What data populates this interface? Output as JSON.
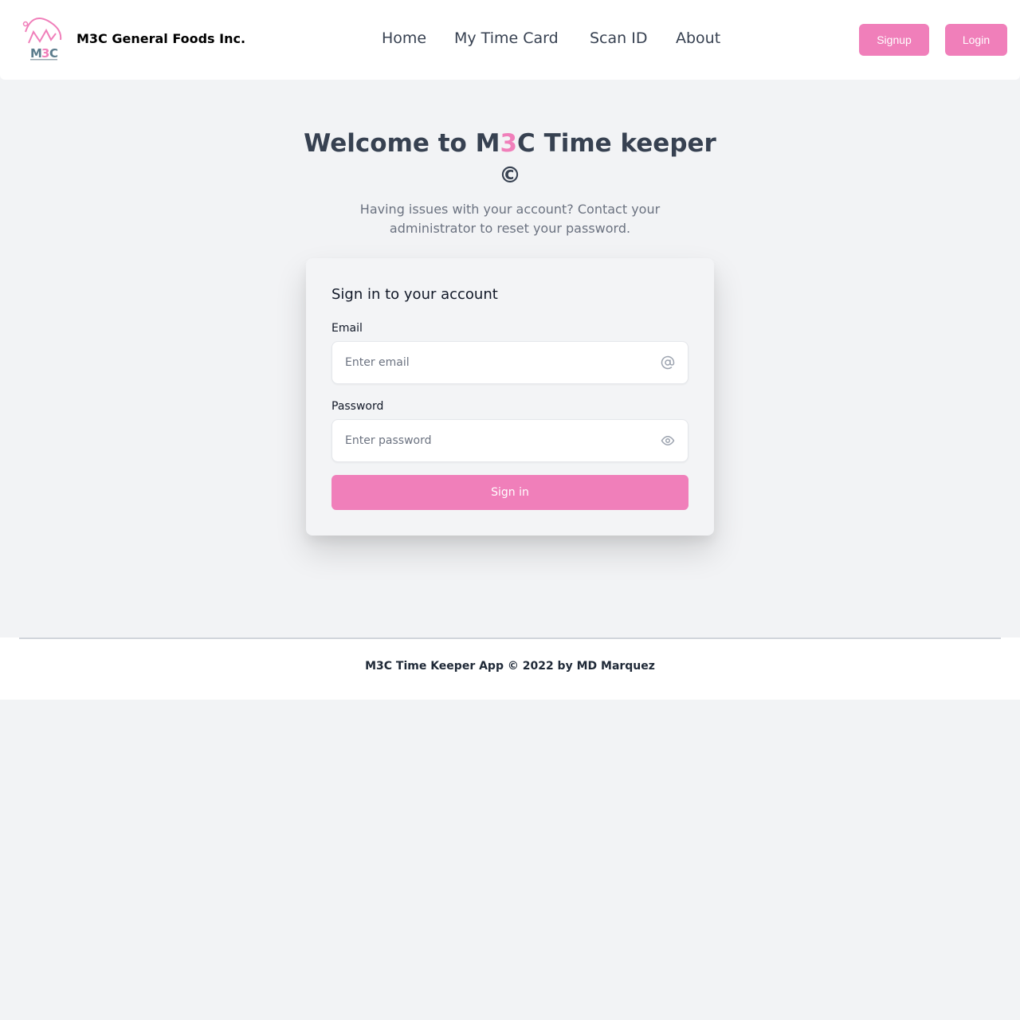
{
  "colors": {
    "accent": "#f07fba",
    "background": "#f2f3f5",
    "text": "#374151"
  },
  "header": {
    "logo_text": "M3C",
    "brand": "M3C General Foods Inc.",
    "nav": [
      "Home",
      "My Time Card",
      "Scan ID",
      "About"
    ],
    "signup_label": "Signup",
    "login_label": "Login"
  },
  "hero": {
    "title_pre": "Welcome to M",
    "title_accent": "3",
    "title_post": "C Time keeper",
    "title_symbol": "©",
    "subtitle": "Having issues with your account? Contact your administrator to reset your password."
  },
  "form": {
    "title": "Sign in to your account",
    "email_label": "Email",
    "email_placeholder": "Enter email",
    "email_icon": "at-sign-icon",
    "password_label": "Password",
    "password_placeholder": "Enter password",
    "password_icon": "eye-icon",
    "submit_label": "Sign in"
  },
  "footer": {
    "copyright": "M3C Time Keeper App © 2022 by MD Marquez"
  }
}
